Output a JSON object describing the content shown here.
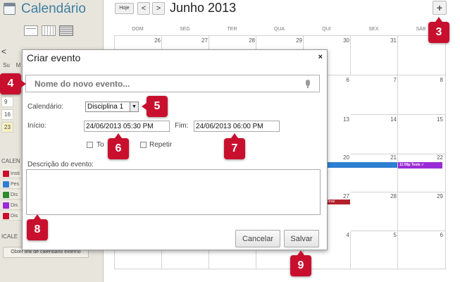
{
  "sidebar": {
    "title": "Calendário",
    "mini_nav": "<",
    "mini_headers": [
      "Su",
      "M"
    ],
    "mini_days": [
      "9",
      "16",
      "23"
    ],
    "calendars_heading": "CALEN",
    "calendar_items": [
      {
        "label": "Insti",
        "color": "#c8102e"
      },
      {
        "label": "Pes",
        "color": "#2e7fd1"
      },
      {
        "label": "Dis",
        "color": "#2f8a2f"
      },
      {
        "label": "Dis",
        "color": "#9a2bd6"
      },
      {
        "label": "Dis",
        "color": "#c8102e"
      }
    ],
    "ical_heading": "ICALE",
    "ext_link_button": "Obter link de calendário externo"
  },
  "toolbar": {
    "today_button": "Hoje",
    "prev": "<",
    "next": ">",
    "month_title": "Junho 2013",
    "add_button": "+"
  },
  "calendar": {
    "weekdays": [
      "DOM",
      "SEG",
      "TER",
      "QUA",
      "QUI",
      "SEX",
      "SÁB"
    ],
    "visible_numbers": {
      "row0": [
        "26",
        "27",
        "28",
        "29",
        "30",
        "31",
        "1"
      ],
      "row1_right": [
        "6",
        "7",
        "8"
      ],
      "row2_right": [
        "13",
        "14",
        "15"
      ],
      "row3_right": [
        "20",
        "21",
        "22"
      ],
      "row4_right": [
        "27",
        "28",
        "29"
      ],
      "row5_right": [
        "4",
        "5",
        "6"
      ]
    },
    "events": {
      "purple_event": "11:59p Teste ✓",
      "red_event": "Final"
    }
  },
  "dialog": {
    "title": "Criar evento",
    "close": "×",
    "event_name_placeholder": "Nome do novo evento...",
    "calendar_label": "Calendário:",
    "calendar_value": "Disciplina 1",
    "start_label": "Início:",
    "start_value": "24/06/2013 05:30 PM",
    "end_label": "Fim:",
    "end_value": "24/06/2013 06:00 PM",
    "allday_label": "To",
    "repeat_label": "Repetir",
    "description_label": "Descrição do evento:",
    "cancel_button": "Cancelar",
    "save_button": "Salvar"
  },
  "callouts": [
    "3",
    "4",
    "5",
    "6",
    "7",
    "8",
    "9"
  ],
  "colors": {
    "badge": "#c8102e",
    "title_blue": "#3e7fa3",
    "event_blue": "#2e7fd1",
    "event_purple": "#9a2bd6",
    "event_red": "#b3202a"
  }
}
